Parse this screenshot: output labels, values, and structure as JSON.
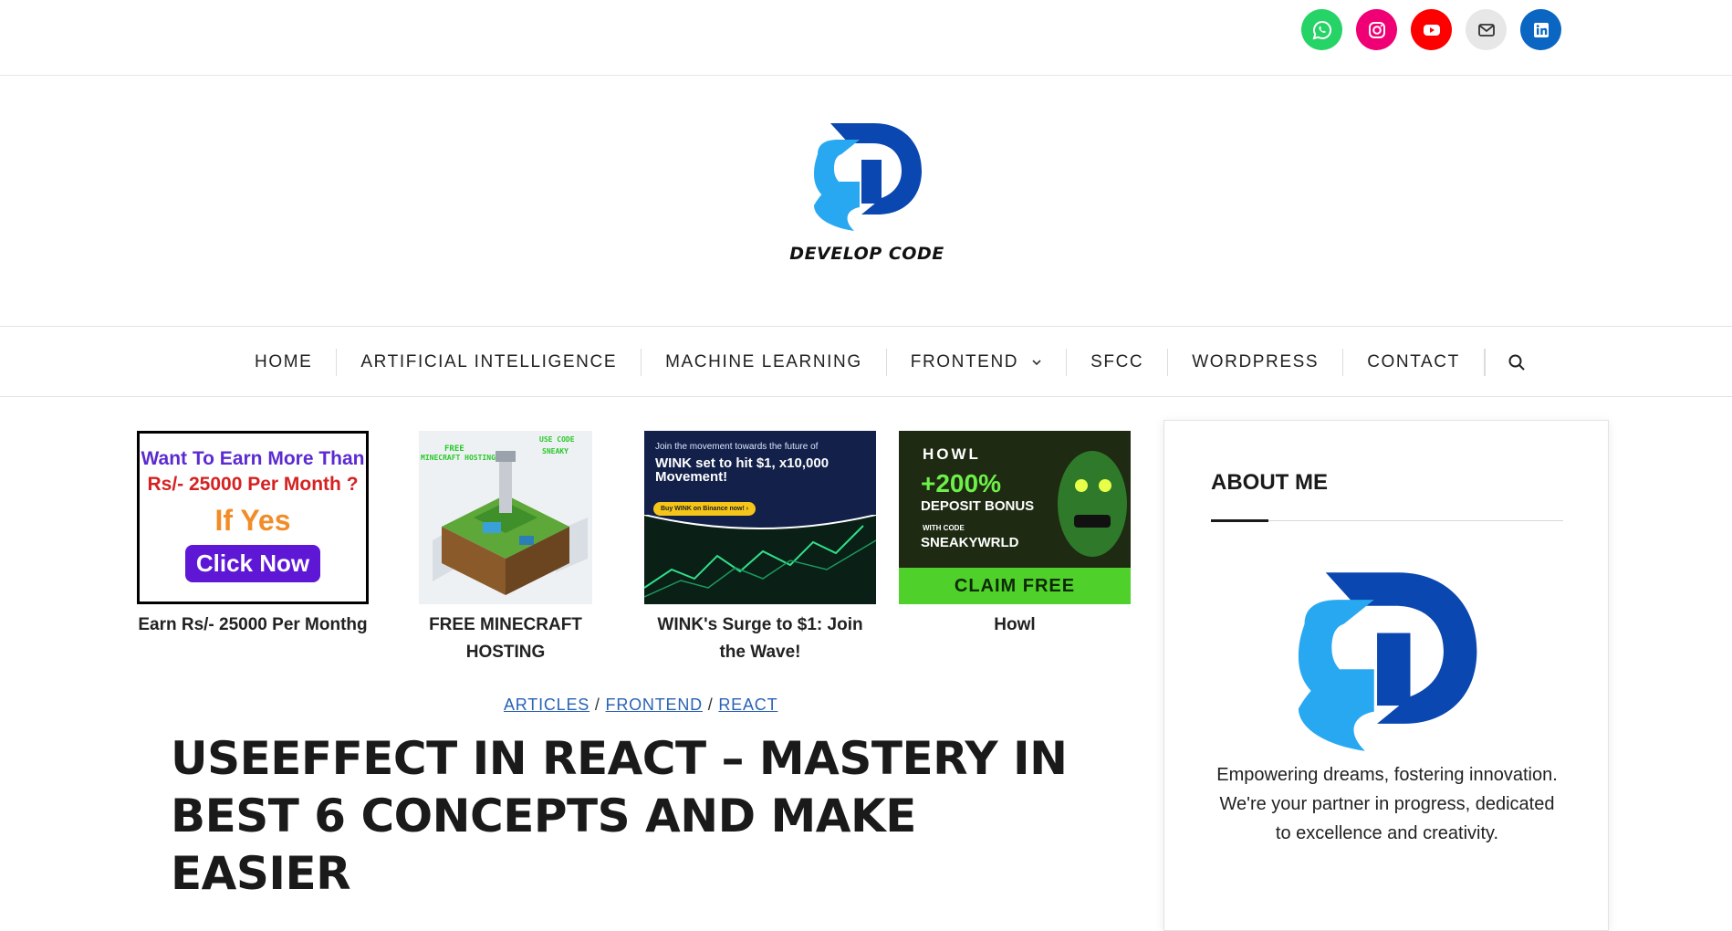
{
  "social": [
    {
      "icon": "whatsapp-icon",
      "color": "#25d366"
    },
    {
      "icon": "instagram-icon",
      "color": "#f00075"
    },
    {
      "icon": "youtube-icon",
      "color": "#ff0000"
    },
    {
      "icon": "mail-icon",
      "color": "#e7e7e7"
    },
    {
      "icon": "linkedin-icon",
      "color": "#0a66c2"
    }
  ],
  "brand": {
    "name": "DEVELOP CODE",
    "logo_dark": "#0b47b0",
    "logo_light": "#29a8f2"
  },
  "nav": {
    "items": [
      "HOME",
      "ARTIFICIAL INTELLIGENCE",
      "MACHINE LEARNING",
      "FRONTEND",
      "SFCC",
      "WORDPRESS",
      "CONTACT"
    ],
    "search_icon": "search-icon"
  },
  "ads": [
    {
      "caption": "Earn Rs/- 25000 Per Monthg",
      "image": {
        "line1": "Want To Earn More Than",
        "line2": "Rs/- 25000 Per Month ?",
        "line3": "If Yes",
        "button": "Click Now"
      }
    },
    {
      "caption": "FREE MINECRAFT HOSTING"
    },
    {
      "caption": "WINK's Surge to $1: Join the Wave!",
      "image": {
        "line1": "Join the movement towards the future of",
        "line2": "WINK set to hit $1, x10,000 Movement!",
        "button": "Buy WINK on Binance now! ›"
      }
    },
    {
      "caption": "Howl",
      "image": {
        "brand": "HOWL",
        "line1": "+200%",
        "line2": "DEPOSIT BONUS",
        "line3": "WITH CODE",
        "line4": "SNEAKYWRLD",
        "button": "CLAIM FREE"
      }
    }
  ],
  "breadcrumbs": [
    "ARTICLES",
    "FRONTEND",
    "REACT"
  ],
  "article": {
    "title": "USEEFFECT IN REACT – MASTERY IN BEST 6 CONCEPTS AND MAKE EASIER"
  },
  "sidebar": {
    "title": "ABOUT ME",
    "text": "Empowering dreams, fostering innovation. We're your partner in progress, dedicated to excellence and creativity."
  }
}
